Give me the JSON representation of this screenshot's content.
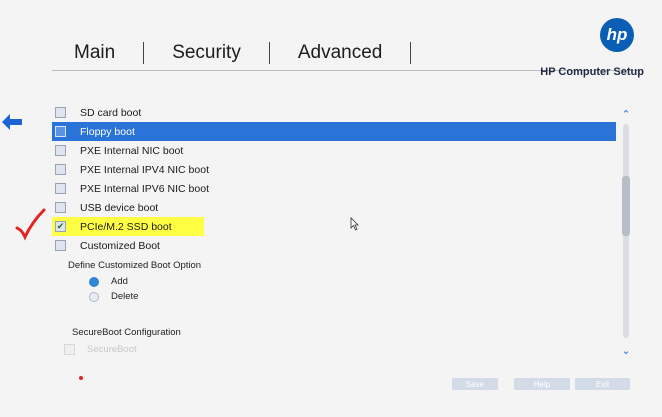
{
  "tabs": [
    {
      "label": "Main"
    },
    {
      "label": "Security"
    },
    {
      "label": "Advanced"
    }
  ],
  "brand": {
    "logo_text": "hp",
    "subtitle": "HP Computer Setup"
  },
  "boot_options": [
    {
      "label": "SD card boot",
      "checked": false,
      "state": "normal"
    },
    {
      "label": "Floppy boot",
      "checked": false,
      "state": "selected"
    },
    {
      "label": "PXE Internal NIC boot",
      "checked": false,
      "state": "normal"
    },
    {
      "label": "PXE Internal IPV4 NIC boot",
      "checked": false,
      "state": "normal"
    },
    {
      "label": "PXE Internal IPV6 NIC boot",
      "checked": false,
      "state": "normal"
    },
    {
      "label": "USB device boot",
      "checked": false,
      "state": "normal"
    },
    {
      "label": "PCIe/M.2 SSD boot",
      "checked": true,
      "state": "highlighted"
    },
    {
      "label": "Customized Boot",
      "checked": false,
      "state": "normal"
    }
  ],
  "customized_boot": {
    "title": "Define Customized Boot Option",
    "options": [
      {
        "label": "Add",
        "selected": true
      },
      {
        "label": "Delete",
        "selected": false
      }
    ]
  },
  "secure_boot": {
    "title": "SecureBoot Configuration",
    "item": "SecureBoot"
  },
  "footer_buttons": [
    {
      "label": "Save"
    },
    {
      "label": "Help"
    },
    {
      "label": "Exit"
    }
  ],
  "colors": {
    "accent": "#2a73d8",
    "highlight": "#ffff44",
    "annotation": "#e52222"
  },
  "icons": [
    "left-arrow-icon",
    "checkmark-annotation-icon",
    "mouse-cursor-icon",
    "scroll-up-icon",
    "scroll-down-icon"
  ]
}
